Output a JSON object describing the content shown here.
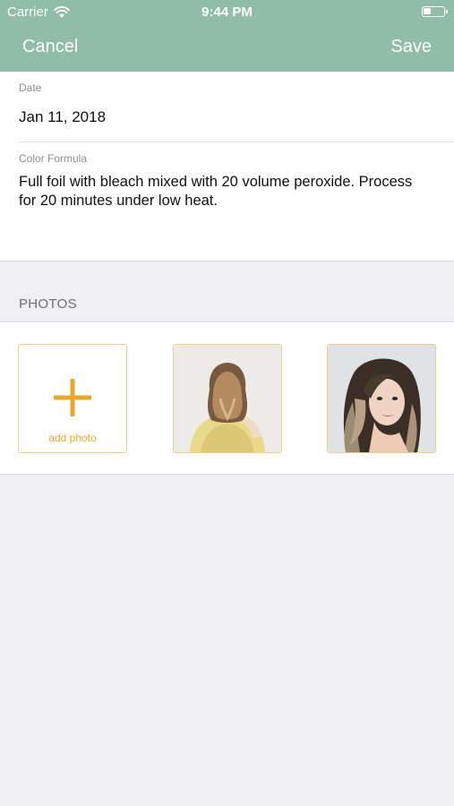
{
  "status_bar": {
    "carrier": "Carrier",
    "time": "9:44 PM",
    "wifi_icon": "wifi-icon",
    "battery_icon": "battery-icon"
  },
  "nav": {
    "cancel_label": "Cancel",
    "save_label": "Save",
    "bar_color": "#8fbda6"
  },
  "form": {
    "date_label": "Date",
    "date_value": "Jan 11, 2018",
    "formula_label": "Color Formula",
    "formula_value": "Full foil with bleach mixed with 20 volume peroxide. Process for 20 minutes under low heat."
  },
  "photos": {
    "section_title": "PHOTOS",
    "add_label": "add photo",
    "add_icon": "plus-icon",
    "accent_color": "#e6a82a",
    "items": [
      {
        "kind": "photo",
        "description_icon": "back-of-head-photo"
      },
      {
        "kind": "photo",
        "description_icon": "portrait-photo"
      }
    ]
  }
}
